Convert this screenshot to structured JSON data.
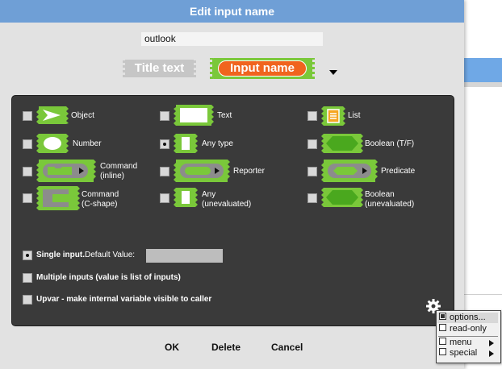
{
  "dialog": {
    "title": "Edit input name",
    "name_value": "outlook",
    "title_text_tab": "Title text",
    "input_name_tab": "Input name"
  },
  "types": {
    "object": "Object",
    "text": "Text",
    "list": "List",
    "number": "Number",
    "any_type": "Any type",
    "boolean": "Boolean (T/F)",
    "command_inline": "Command\n(inline)",
    "reporter": "Reporter",
    "predicate": "Predicate",
    "command_c": "Command\n(C-shape)",
    "any_unevaluated": "Any\n(unevaluated)",
    "boolean_unevaluated": "Boolean\n(unevaluated)"
  },
  "input_mode": {
    "single": "Single input.",
    "default_value_label": "Default Value:",
    "default_value": "",
    "multiple": "Multiple inputs (value is list of inputs)",
    "upvar": "Upvar - make internal variable visible to caller"
  },
  "buttons": {
    "ok": "OK",
    "delete": "Delete",
    "cancel": "Cancel"
  },
  "menu": {
    "options": "options...",
    "read_only": "read-only",
    "menu": "menu",
    "special": "special"
  },
  "colors": {
    "titlebar": "#6f9fd6",
    "panel": "#3a3a3a",
    "block_green": "#7ac83a",
    "input_orange": "#f0641e"
  },
  "icons": [
    "gear-icon",
    "dropdown-arrow-icon",
    "submenu-arrow-icon"
  ]
}
